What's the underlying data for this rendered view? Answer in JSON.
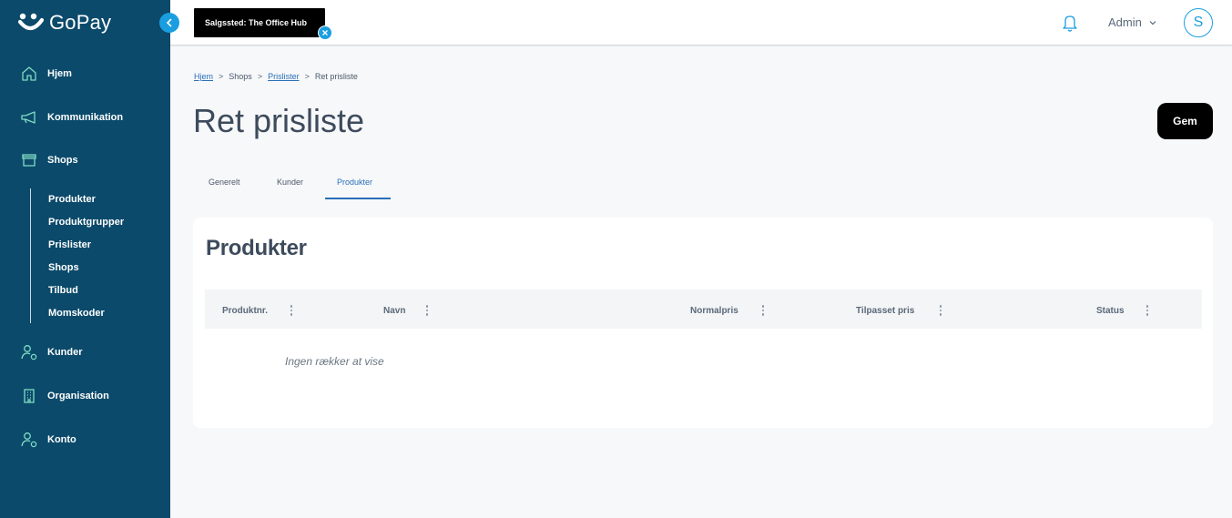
{
  "app": {
    "name": "GoPay"
  },
  "sidebar": {
    "items": [
      {
        "label": "Hjem",
        "icon": "home-icon"
      },
      {
        "label": "Kommunikation",
        "icon": "megaphone-icon"
      },
      {
        "label": "Shops",
        "icon": "store-icon"
      },
      {
        "label": "Kunder",
        "icon": "user-gear-icon"
      },
      {
        "label": "Organisation",
        "icon": "building-icon"
      },
      {
        "label": "Konto",
        "icon": "user-gear-icon"
      }
    ],
    "shops_sub": [
      "Produkter",
      "Produktgrupper",
      "Prislister",
      "Shops",
      "Tilbud",
      "Momskoder"
    ],
    "active_sub": "Prislister"
  },
  "topbar": {
    "salgssted": "Salgssted: The Office Hub",
    "user": "Admin",
    "avatar_initial": "S"
  },
  "breadcrumb": [
    "Hjem",
    "Shops",
    "Prislister",
    "Ret prisliste"
  ],
  "page": {
    "title": "Ret prisliste",
    "save_label": "Gem"
  },
  "tabs": [
    {
      "label": "Generelt",
      "active": false
    },
    {
      "label": "Kunder",
      "active": false
    },
    {
      "label": "Produkter",
      "active": true
    }
  ],
  "card": {
    "title": "Produkter",
    "columns": [
      "Produktnr.",
      "Navn",
      "Normalpris",
      "Tilpasset pris",
      "Status"
    ],
    "empty_text": "Ingen rækker at vise"
  },
  "colors": {
    "sidebar": "#0b4a6b",
    "accent": "#1b9ee0",
    "link": "#2a6fb8"
  }
}
